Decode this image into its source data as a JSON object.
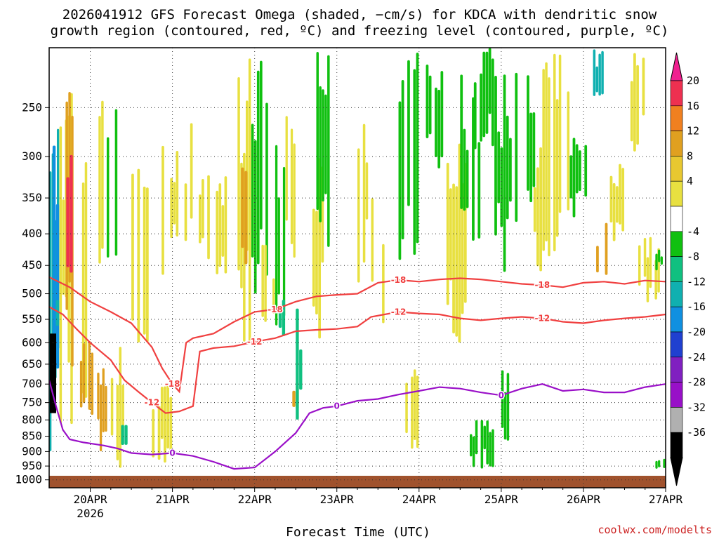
{
  "title": {
    "line1": "2026041912 GFS Forecast Omega (shaded, −cm/s) for KDCA with dendritic snow",
    "line2": "growth region (contoured, red, ºC) and freezing level (contoured, purple, ºC)"
  },
  "credit": "coolwx.com/modelts",
  "chart_data": {
    "type": "heatmap",
    "xlabel": "Forecast Time (UTC)",
    "x_ticks": [
      "20APR",
      "21APR",
      "22APR",
      "23APR",
      "24APR",
      "25APR",
      "26APR",
      "27APR"
    ],
    "x_tick_sub": "2026",
    "x_range_hours": [
      -12,
      168
    ],
    "y_axis": "pressure (hPa), log scale, reversed",
    "y_ticks": [
      250,
      300,
      350,
      400,
      450,
      500,
      550,
      600,
      650,
      700,
      750,
      800,
      850,
      900,
      950,
      1000
    ],
    "ylim": [
      200,
      1030
    ],
    "grid": true,
    "colorbar": {
      "labels": [
        "20",
        "16",
        "12",
        "8",
        "4",
        "-4",
        "-8",
        "-12",
        "-16",
        "-20",
        "-24",
        "-28",
        "-32",
        "-36"
      ],
      "colors": [
        "#ee3050",
        "#f08020",
        "#e0a020",
        "#e8c830",
        "#e8e040",
        "#ffffff",
        "#10c010",
        "#10c080",
        "#10b0b0",
        "#1090e0",
        "#2040d0",
        "#8020c0",
        "#9810c8",
        "#b0b0b0",
        "#000000"
      ],
      "top_arrow_color": "#f02090",
      "bottom_arrow_color": "#000000"
    },
    "contours": [
      {
        "level": -18,
        "color": "#f04040",
        "labels": [
          "-18",
          "-18",
          "-18",
          "-18"
        ],
        "points": [
          [
            -12,
            470
          ],
          [
            -6,
            488
          ],
          [
            0,
            515
          ],
          [
            6,
            535
          ],
          [
            12,
            558
          ],
          [
            18,
            610
          ],
          [
            21,
            660
          ],
          [
            24,
            700
          ],
          [
            26,
            720
          ],
          [
            28,
            600
          ],
          [
            30,
            590
          ],
          [
            36,
            580
          ],
          [
            42,
            555
          ],
          [
            48,
            535
          ],
          [
            54,
            530
          ],
          [
            60,
            515
          ],
          [
            66,
            505
          ],
          [
            72,
            502
          ],
          [
            78,
            500
          ],
          [
            84,
            480
          ],
          [
            90,
            475
          ],
          [
            96,
            478
          ],
          [
            102,
            474
          ],
          [
            108,
            472
          ],
          [
            114,
            474
          ],
          [
            120,
            478
          ],
          [
            126,
            482
          ],
          [
            132,
            484
          ],
          [
            138,
            488
          ],
          [
            144,
            480
          ],
          [
            150,
            478
          ],
          [
            156,
            482
          ],
          [
            162,
            476
          ],
          [
            168,
            478
          ]
        ]
      },
      {
        "level": -12,
        "color": "#f04040",
        "labels": [
          "-12",
          "-12",
          "-12",
          "-12"
        ],
        "points": [
          [
            -12,
            525
          ],
          [
            -8,
            540
          ],
          [
            -4,
            570
          ],
          [
            0,
            600
          ],
          [
            6,
            640
          ],
          [
            10,
            690
          ],
          [
            14,
            720
          ],
          [
            18,
            750
          ],
          [
            22,
            780
          ],
          [
            26,
            775
          ],
          [
            30,
            760
          ],
          [
            32,
            620
          ],
          [
            36,
            612
          ],
          [
            42,
            608
          ],
          [
            48,
            598
          ],
          [
            54,
            590
          ],
          [
            60,
            575
          ],
          [
            66,
            572
          ],
          [
            72,
            570
          ],
          [
            78,
            565
          ],
          [
            82,
            545
          ],
          [
            90,
            535
          ],
          [
            96,
            538
          ],
          [
            102,
            540
          ],
          [
            108,
            548
          ],
          [
            114,
            552
          ],
          [
            120,
            548
          ],
          [
            126,
            545
          ],
          [
            132,
            548
          ],
          [
            138,
            555
          ],
          [
            144,
            558
          ],
          [
            150,
            552
          ],
          [
            156,
            548
          ],
          [
            162,
            545
          ],
          [
            168,
            540
          ]
        ]
      },
      {
        "level": 0,
        "color": "#9a10c8",
        "labels": [
          "0",
          "0",
          "0"
        ],
        "points": [
          [
            -12,
            690
          ],
          [
            -10,
            760
          ],
          [
            -8,
            830
          ],
          [
            -6,
            860
          ],
          [
            -2,
            870
          ],
          [
            4,
            880
          ],
          [
            8,
            890
          ],
          [
            12,
            905
          ],
          [
            18,
            910
          ],
          [
            24,
            905
          ],
          [
            30,
            915
          ],
          [
            36,
            935
          ],
          [
            42,
            960
          ],
          [
            48,
            955
          ],
          [
            54,
            900
          ],
          [
            60,
            840
          ],
          [
            64,
            780
          ],
          [
            68,
            765
          ],
          [
            72,
            760
          ],
          [
            78,
            745
          ],
          [
            84,
            740
          ],
          [
            90,
            728
          ],
          [
            96,
            718
          ],
          [
            102,
            708
          ],
          [
            108,
            712
          ],
          [
            114,
            722
          ],
          [
            120,
            730
          ],
          [
            126,
            712
          ],
          [
            132,
            700
          ],
          [
            138,
            718
          ],
          [
            144,
            714
          ],
          [
            150,
            722
          ],
          [
            156,
            722
          ],
          [
            162,
            708
          ],
          [
            168,
            700
          ]
        ]
      }
    ],
    "shaded_cells_note": "omega shading (-cm/s), scattered cells approximated",
    "surface_color": "#a0522d"
  }
}
